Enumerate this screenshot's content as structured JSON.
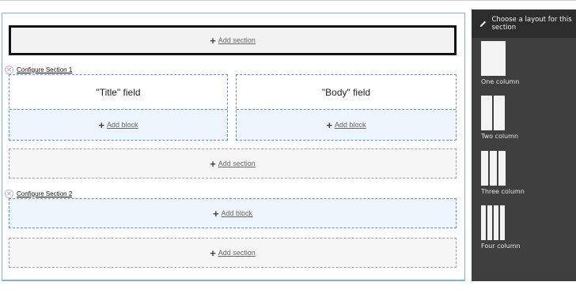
{
  "canvas": {
    "add_section_label": "Add section",
    "add_block_label": "Add block",
    "sections": [
      {
        "configure_label": "Configure Section 1",
        "columns": [
          {
            "field": "\"Title\" field"
          },
          {
            "field": "\"Body\" field"
          }
        ]
      },
      {
        "configure_label": "Configure Section 2"
      }
    ]
  },
  "sidebar": {
    "title": "Choose a layout for this section",
    "layouts": [
      {
        "label": "One column",
        "columns": 1
      },
      {
        "label": "Two column",
        "columns": 2
      },
      {
        "label": "Three column",
        "columns": 3
      },
      {
        "label": "Four column",
        "columns": 4
      }
    ]
  },
  "colors": {
    "region_border": "#4f98cf",
    "region_fill": "#eef4fb",
    "sidebar_bg": "#3f3f3f",
    "sidebar_header_bg": "#2d2d2d"
  }
}
